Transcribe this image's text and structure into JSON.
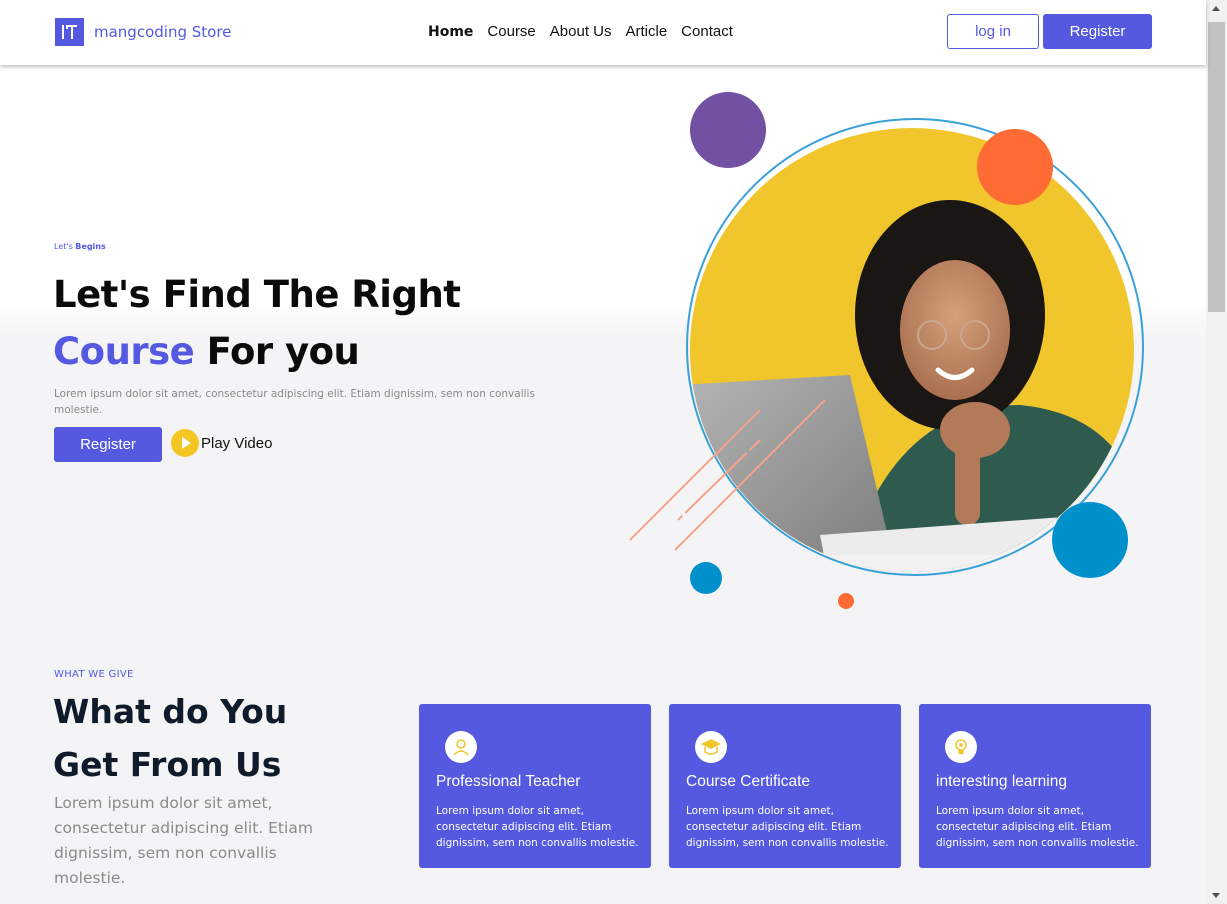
{
  "nav": {
    "brand": "mangcoding Store",
    "links": [
      "Home",
      "Course",
      "About Us",
      "Article",
      "Contact"
    ],
    "login_label": "log in",
    "register_label": "Register"
  },
  "hero": {
    "eyebrow_prefix": "Let's",
    "eyebrow_bold": "Begins",
    "title_line1": "Let's Find The Right",
    "title_accent": "Course",
    "title_rest": "For you",
    "description": "Lorem ipsum dolor sit amet, consectetur adipiscing elit. Etiam dignissim, sem non convallis molestie.",
    "register_label": "Register",
    "play_label": "Play Video"
  },
  "what_we_give": {
    "eyebrow": "WHAT WE GIVE",
    "title_line1": "What do You",
    "title_line2": "Get From Us",
    "description": "Lorem ipsum dolor sit amet, consectetur adipiscing elit. Etiam dignissim, sem non convallis molestie.",
    "cards": [
      {
        "icon": "teacher-icon",
        "title": "Professional Teacher",
        "text": "Lorem ipsum dolor sit amet, consectetur adipiscing elit. Etiam dignissim, sem non convallis molestie."
      },
      {
        "icon": "graduation-cap-icon",
        "title": "Course Certificate",
        "text": "Lorem ipsum dolor sit amet, consectetur adipiscing elit. Etiam dignissim, sem non convallis molestie."
      },
      {
        "icon": "lightbulb-icon",
        "title": "interesting learning",
        "text": "Lorem ipsum dolor sit amet, consectetur adipiscing elit. Etiam dignissim, sem non convallis molestie."
      }
    ]
  },
  "colors": {
    "primary": "#5459e0",
    "yellow": "#f3c623",
    "orange": "#ff6b35",
    "purple": "#7251a2",
    "blue": "#0091cd"
  }
}
